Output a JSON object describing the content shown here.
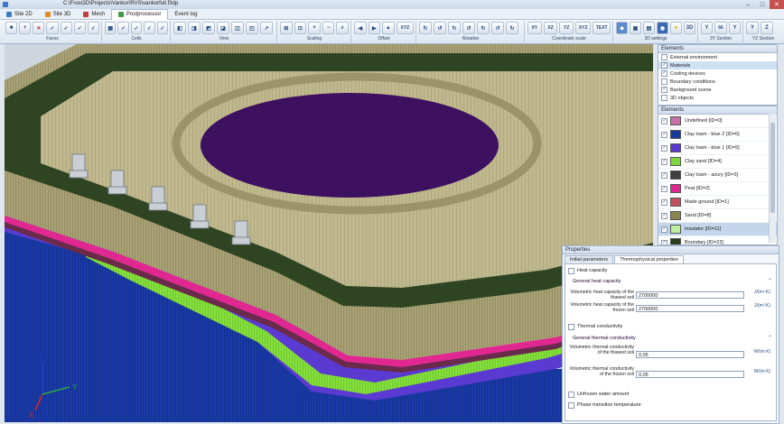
{
  "window": {
    "title": "C:\\Frost3D\\Projects\\Vankor\\RVS\\vankorfull.f3dp"
  },
  "menu": [
    {
      "label": "Site 2D",
      "color": "#3a78c8"
    },
    {
      "label": "Site 3D",
      "color": "#e08a20"
    },
    {
      "label": "Mesh",
      "color": "#c03b3b"
    },
    {
      "label": "Postprocessor",
      "color": "#3a9c48"
    },
    {
      "label": "Event log",
      "color": ""
    }
  ],
  "ribbon": {
    "groups": [
      "Faces",
      "Cells",
      "View",
      "Scaling",
      "Offset",
      "Rotation",
      "Coordinate scale",
      "3D settings",
      "3Y Section",
      "YZ Section"
    ],
    "zoom_value": "66",
    "btn_xyz": "XYZ",
    "btn_text": "TEXT",
    "btn_xy": "XY",
    "btn_xz": "XZ",
    "btn_yz": "YZ"
  },
  "axes": {
    "z": "Z",
    "y": "Y",
    "x": "X"
  },
  "elements_top": {
    "header": "Elements",
    "items": [
      {
        "label": "External environment",
        "checked": false
      },
      {
        "label": "Materials",
        "checked": true,
        "selected": true
      },
      {
        "label": "Cooling devices",
        "checked": true
      },
      {
        "label": "Boundary conditions",
        "checked": false
      },
      {
        "label": "Background scene",
        "checked": true
      },
      {
        "label": "3D objects",
        "checked": false
      }
    ]
  },
  "elements_list": {
    "header": "Elements",
    "items": [
      {
        "label": "Undefined [ID=0]",
        "color": "#c870a8"
      },
      {
        "label": "Clay loam - blue 2 [ID=6]",
        "color": "#1a3a9a"
      },
      {
        "label": "Clay loam - blue 1 [ID=5]",
        "color": "#5a3ad0"
      },
      {
        "label": "Clay sand [ID=4]",
        "color": "#7ed83a"
      },
      {
        "label": "Clay loam - azury [ID=3]",
        "color": "#404040"
      },
      {
        "label": "Peat [ID=2]",
        "color": "#e02890"
      },
      {
        "label": "Made ground [ID=1]",
        "color": "#c05060"
      },
      {
        "label": "Sand [ID=8]",
        "color": "#8a8450"
      },
      {
        "label": "Insulator [ID=11]",
        "color": "#bff0a0",
        "selected": true
      },
      {
        "label": "Boundary [ID=23]",
        "color": "#28401e"
      },
      {
        "label": "TankLand [ID=10]",
        "color": "#3e1060"
      }
    ]
  },
  "properties": {
    "header": "Properties",
    "tabs": [
      "Initial parameters",
      "Thermophysical properties"
    ],
    "heat_capacity": {
      "section": "Heat capacity",
      "subsection": "General heat capacity",
      "thawed_label": "Volumetric heat capacity of the thawed soil",
      "thawed_value": "2700000",
      "frozen_label": "Volumetric heat capacity of the frozen soil",
      "frozen_value": "2700000",
      "unit": "J/(m³·K)"
    },
    "thermal_conductivity": {
      "section": "Thermal conductivity",
      "subsection": "General thermal conductivity",
      "thawed_label": "Volumetric thermal conductivity of the thawed soil",
      "thawed_value": "0.05",
      "frozen_label": "Volumetric thermal conductivity of the frozen soil",
      "frozen_value": "0.05",
      "unit": "W/(m·K)"
    },
    "unfrozen": "Unfrozen water amount",
    "phase": "Phase transition temperature"
  },
  "icons": [
    "app-icon",
    "minimize-icon",
    "maximize-icon",
    "close-icon",
    "chevron-down-icon",
    "checkbox-icon"
  ]
}
